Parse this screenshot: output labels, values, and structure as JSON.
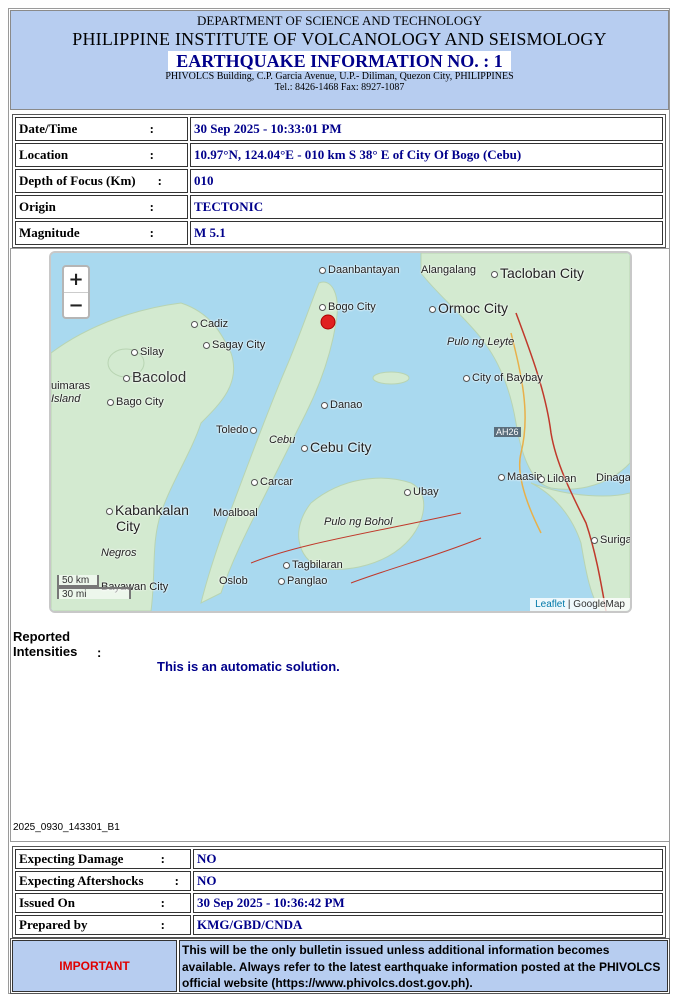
{
  "header": {
    "department": "DEPARTMENT OF SCIENCE AND TECHNOLOGY",
    "institute": "PHILIPPINE INSTITUTE OF VOLCANOLOGY AND SEISMOLOGY",
    "eq_info": "EARTHQUAKE INFORMATION NO. :  1",
    "address": "PHIVOLCS Building, C.P. Garcia Avenue, U.P.- Diliman, Quezon City, PHILIPPINES",
    "tel": "Tel.: 8426-1468  Fax: 8927-1087"
  },
  "info": {
    "datetime_label": "Date/Time",
    "datetime_value": "30 Sep 2025 - 10:33:01 PM",
    "location_label": "Location",
    "location_value": "10.97°N, 124.04°E - 010 km S 38° E of City Of Bogo (Cebu)",
    "depth_label": "Depth of Focus (Km)",
    "depth_value": "010",
    "origin_label": "Origin",
    "origin_value": "TECTONIC",
    "magnitude_label": "Magnitude",
    "magnitude_value": "M 5.1",
    "colon": ":"
  },
  "map": {
    "zoom_in": "+",
    "zoom_out": "−",
    "scale_km": "50 km",
    "scale_mi": "30 mi",
    "attrib_leaflet": "Leaflet",
    "attrib_sep": " | ",
    "attrib_google": "GoogleMap",
    "places": {
      "daanbantayan": "Daanbantayan",
      "alangalang": "Alangalang",
      "tacloban": "Tacloban City",
      "bogo": "Bogo City",
      "ormoc": "Ormoc City",
      "cadiz": "Cadiz",
      "silay": "Silay",
      "sagay": "Sagay City",
      "pulo_leyte": "Pulo ng Leyte",
      "bacolod": "Bacolod",
      "guimaras": "uimaras",
      "island": "Island",
      "bago": "Bago City",
      "baybay": "City of Baybay",
      "danao": "Danao",
      "toledo": "Toledo",
      "cebu": "Cebu",
      "cebu_city": "Cebu City",
      "ah26": "AH26",
      "maasin": "Maasin",
      "liloan": "Liloan",
      "dinaga": "Dinaga",
      "carcar": "Carcar",
      "ubay": "Ubay",
      "kabankalan": "Kabankalan",
      "kab_city": "City",
      "moalboal": "Moalboal",
      "pulo_bohol": "Pulo ng Bohol",
      "negros": "Negros",
      "surigao": "Surigao",
      "tagbilaran": "Tagbilaran",
      "bayawan": "Bayawan City",
      "oslob": "Oslob",
      "panglao": "Panglao"
    },
    "colors": {
      "sea": "#a9d9ef",
      "land": "#d3ead0",
      "epicenter": "#e02020"
    }
  },
  "reported": {
    "label_line1": "Reported",
    "label_line2": "Intensities",
    "colon": ":",
    "automatic": "This is an automatic solution.",
    "bulletin_id": "2025_0930_143301_B1"
  },
  "bottom": {
    "damage_label": "Expecting Damage",
    "damage_value": "NO",
    "aftershocks_label": "Expecting Aftershocks",
    "aftershocks_value": "NO",
    "issued_label": "Issued On",
    "issued_value": "30 Sep 2025 - 10:36:42 PM",
    "prepared_label": "Prepared by",
    "prepared_value": "KMG/GBD/CNDA"
  },
  "important": {
    "label": "IMPORTANT",
    "text": "This will be the only bulletin issued unless additional information becomes available. Always refer to the latest earthquake information posted at the PHIVOLCS official website (https://www.phivolcs.dost.gov.ph)."
  }
}
